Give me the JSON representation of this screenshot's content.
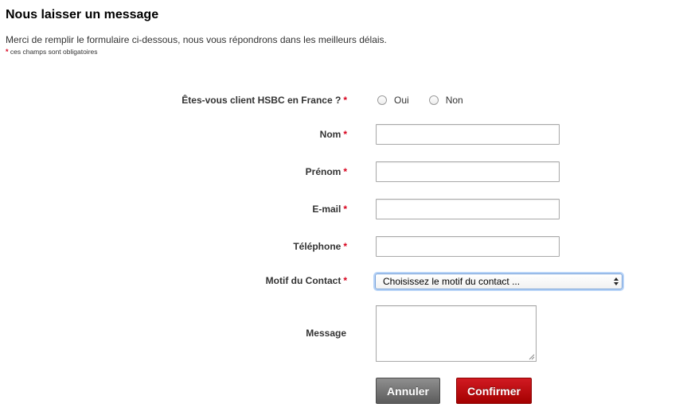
{
  "header": {
    "title": "Nous laisser un message",
    "intro": "Merci de remplir le formulaire ci-dessous, nous vous répondrons dans les meilleurs délais.",
    "required_star": "*",
    "required_note": "ces champs sont obligatoires"
  },
  "form": {
    "client_question": {
      "label": "Êtes-vous client HSBC en France ?",
      "required": "*",
      "options": [
        "Oui",
        "Non"
      ],
      "selected": null
    },
    "nom": {
      "label": "Nom",
      "required": "*",
      "value": ""
    },
    "prenom": {
      "label": "Prénom",
      "required": "*",
      "value": ""
    },
    "email": {
      "label": "E-mail",
      "required": "*",
      "value": ""
    },
    "telephone": {
      "label": "Téléphone",
      "required": "*",
      "value": ""
    },
    "motif": {
      "label": "Motif du Contact",
      "required": "*",
      "selected_option": "Choisissez le motif du contact ..."
    },
    "message": {
      "label": "Message",
      "value": ""
    }
  },
  "buttons": {
    "cancel": "Annuler",
    "confirm": "Confirmer"
  },
  "colors": {
    "required_star": "#d8001c",
    "confirm_button": "#b5000b",
    "cancel_button": "#6e6e6e",
    "select_focus": "#7aa3d9"
  }
}
